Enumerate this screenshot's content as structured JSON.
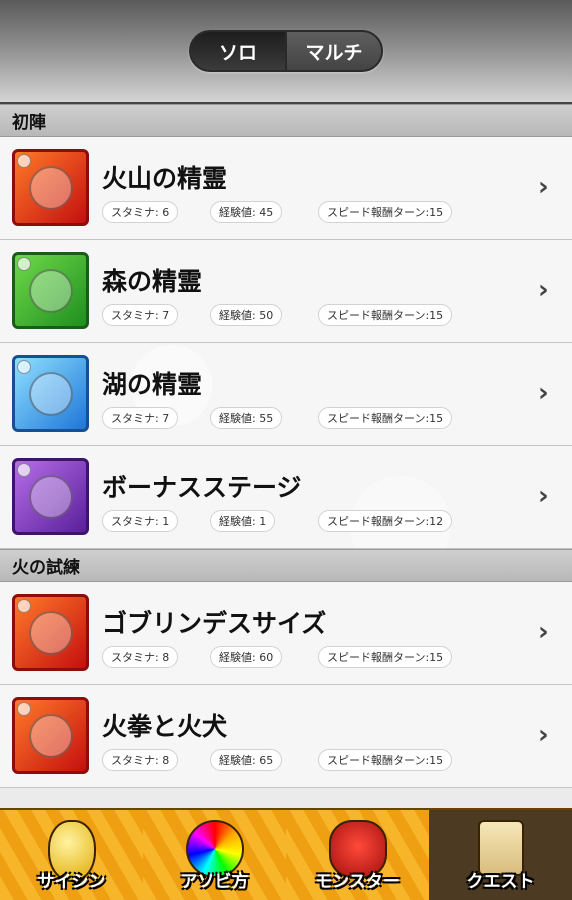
{
  "mode_toggle": {
    "solo_label": "ソロ",
    "multi_label": "マルチ",
    "selected": "ソロ"
  },
  "sections": [
    {
      "title": "初陣",
      "quests": [
        {
          "name": "火山の精霊",
          "icon": "fire-spirit-icon",
          "attribute": "fire",
          "stamina": "スタミナ: 6",
          "exp": "経験値: 45",
          "speed": "スピード報酬ターン:15"
        },
        {
          "name": "森の精霊",
          "icon": "forest-spirit-icon",
          "attribute": "wood",
          "stamina": "スタミナ: 7",
          "exp": "経験値: 50",
          "speed": "スピード報酬ターン:15"
        },
        {
          "name": "湖の精霊",
          "icon": "lake-spirit-icon",
          "attribute": "water",
          "stamina": "スタミナ: 7",
          "exp": "経験値: 55",
          "speed": "スピード報酬ターン:15"
        },
        {
          "name": "ボーナスステージ",
          "icon": "bonus-stage-icon",
          "attribute": "dark",
          "stamina": "スタミナ: 1",
          "exp": "経験値: 1",
          "speed": "スピード報酬ターン:12"
        }
      ]
    },
    {
      "title": "火の試練",
      "quests": [
        {
          "name": "ゴブリンデスサイズ",
          "icon": "goblin-icon",
          "attribute": "fire",
          "stamina": "スタミナ: 8",
          "exp": "経験値: 60",
          "speed": "スピード報酬ターン:15"
        },
        {
          "name": "火拳と火犬",
          "icon": "fire-dog-icon",
          "attribute": "fire",
          "stamina": "スタミナ: 8",
          "exp": "経験値: 65",
          "speed": "スピード報酬ターン:15"
        }
      ]
    }
  ],
  "tab_bar": {
    "tabs": [
      {
        "label": "サイシン",
        "icon": "egg-icon"
      },
      {
        "label": "アソビ方",
        "icon": "rainbow-orb-icon"
      },
      {
        "label": "モンスター",
        "icon": "monster-icon"
      },
      {
        "label": "クエスト",
        "icon": "scroll-icon"
      }
    ],
    "selected": "クエスト"
  },
  "colors": {
    "tab_bar": "#f1a30e",
    "tab_selected": "#4c3a22",
    "section_header": "#c4c4c4"
  }
}
